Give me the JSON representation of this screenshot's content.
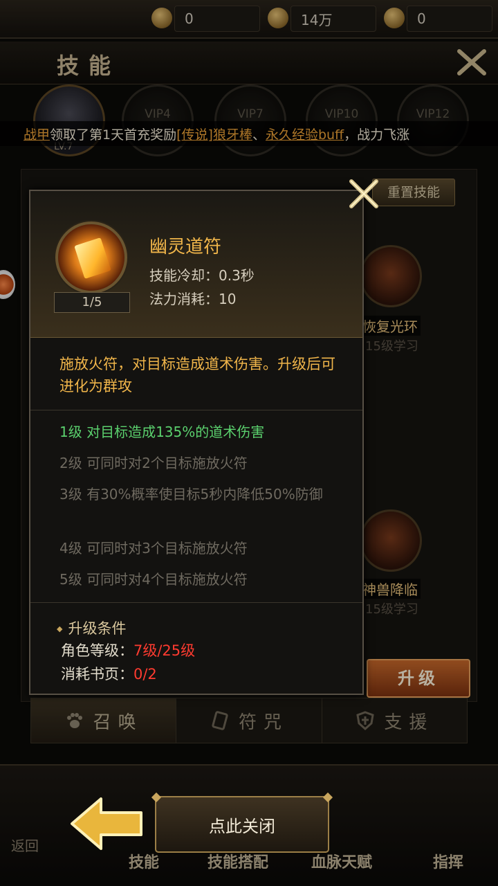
{
  "currency": [
    {
      "icon": "scroll-icon",
      "value": "0"
    },
    {
      "icon": "coin-icon",
      "value": "14万"
    },
    {
      "icon": "ingot-icon",
      "value": "0"
    }
  ],
  "header": {
    "title": "技能"
  },
  "avatar": {
    "level": "LV.7"
  },
  "vip_slots": [
    "VIP4",
    "VIP7",
    "VIP10",
    "VIP12"
  ],
  "marquee": {
    "name": "战甲",
    "text1": "领取了第1天首充奖励",
    "link1": "[传说]狼牙棒",
    "sep": "、",
    "link2": "永久经验buff",
    "text2": "，战力飞涨"
  },
  "reset_button": "重置技能",
  "background_skills": [
    {
      "label": "恢复光环",
      "sub": "15级学习"
    },
    {
      "label": "神兽降临",
      "sub": "15级学习"
    }
  ],
  "upgrade_button": "升级",
  "tabs": [
    {
      "label": "召唤",
      "icon": "paw-icon",
      "active": true
    },
    {
      "label": "符咒",
      "icon": "talisman-icon",
      "active": false
    },
    {
      "label": "支援",
      "icon": "shield-icon",
      "active": false
    }
  ],
  "bottom_nav": {
    "back": "返回",
    "close": "点此关闭",
    "items": [
      "技能",
      "技能搭配",
      "血脉天赋",
      "指挥"
    ]
  },
  "popup": {
    "skill_name": "幽灵道符",
    "level": "1/5",
    "cooldown": "技能冷却：0.3秒",
    "mana": "法力消耗：10",
    "description": "施放火符，对目标造成道术伤害。升级后可进化为群攻",
    "levels": [
      {
        "text": "1级 对目标造成135%的道术伤害",
        "active": true
      },
      {
        "text": "2级 可同时对2个目标施放火符",
        "active": false
      },
      {
        "text": "3级 有30%概率使目标5秒内降低50%防御",
        "active": false
      },
      {
        "text": "4级 可同时对3个目标施放火符",
        "active": false
      },
      {
        "text": "5级 可同时对4个目标施放火符",
        "active": false
      }
    ],
    "condition_title": "升级条件",
    "conditions": [
      {
        "label": "角色等级：",
        "value": "7级/25级"
      },
      {
        "label": "消耗书页：",
        "value": "0/2"
      }
    ]
  }
}
